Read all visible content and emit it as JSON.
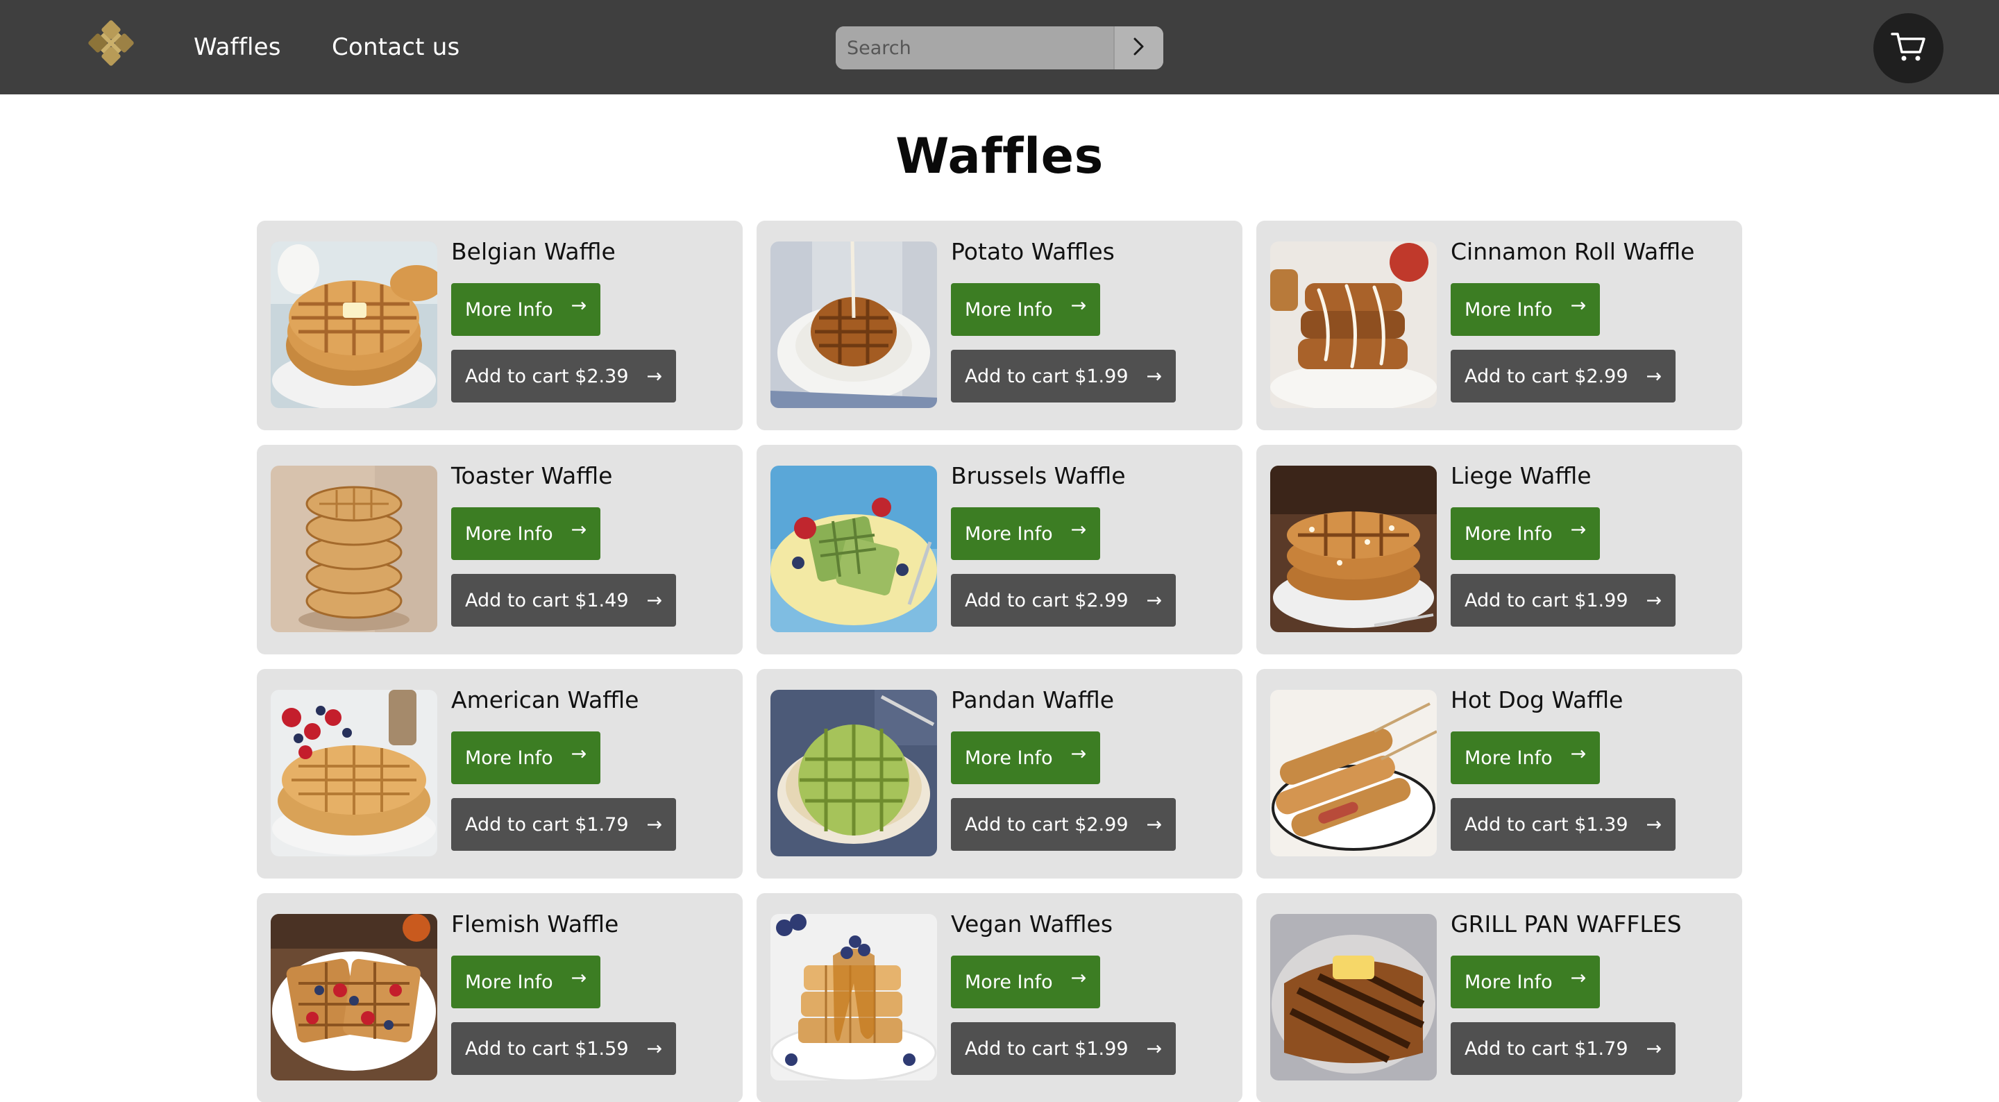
{
  "header": {
    "nav": [
      {
        "label": "Waffles"
      },
      {
        "label": "Contact us"
      }
    ],
    "search": {
      "placeholder": "Search"
    },
    "icons": {
      "logo": "diamond-waffle-logo",
      "search_submit": "chevron-right-icon",
      "cart": "shopping-cart-icon"
    },
    "colors": {
      "background": "#3f3f3f",
      "cart_button": "#1f1f1f"
    }
  },
  "main": {
    "title": "Waffles",
    "button_arrow": "→",
    "colors": {
      "more_info": "#3c7d23",
      "add_to_cart": "#505050",
      "card": "#e3e3e3"
    },
    "products": [
      {
        "name": "Belgian Waffle",
        "more_label": "More Info",
        "cart_label": "Add to cart $2.39"
      },
      {
        "name": "Potato Waffles",
        "more_label": "More Info",
        "cart_label": "Add to cart $1.99"
      },
      {
        "name": "Cinnamon Roll Waffle",
        "more_label": "More Info",
        "cart_label": "Add to cart $2.99"
      },
      {
        "name": "Toaster Waffle",
        "more_label": "More Info",
        "cart_label": "Add to cart $1.49"
      },
      {
        "name": "Brussels Waffle",
        "more_label": "More Info",
        "cart_label": "Add to cart $2.99"
      },
      {
        "name": "Liege Waffle",
        "more_label": "More Info",
        "cart_label": "Add to cart $1.99"
      },
      {
        "name": "American Waffle",
        "more_label": "More Info",
        "cart_label": "Add to cart $1.79"
      },
      {
        "name": "Pandan Waffle",
        "more_label": "More Info",
        "cart_label": "Add to cart $2.99"
      },
      {
        "name": "Hot Dog Waffle",
        "more_label": "More Info",
        "cart_label": "Add to cart $1.39"
      },
      {
        "name": "Flemish Waffle",
        "more_label": "More Info",
        "cart_label": "Add to cart $1.59"
      },
      {
        "name": "Vegan Waffles",
        "more_label": "More Info",
        "cart_label": "Add to cart $1.99"
      },
      {
        "name": "GRILL PAN WAFFLES",
        "more_label": "More Info",
        "cart_label": "Add to cart $1.79"
      }
    ]
  }
}
